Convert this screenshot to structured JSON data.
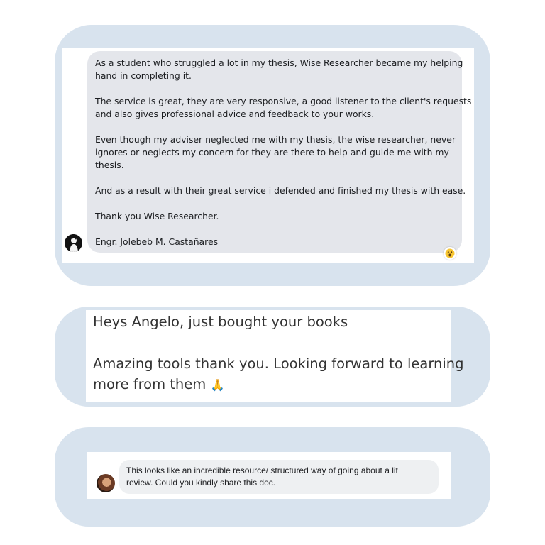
{
  "testimonial_1": {
    "paragraphs": [
      "As a student who struggled a lot in my thesis, Wise Researcher became my helping hand in completing it.",
      "The service is great, they are very responsive, a good listener to the client's requests and also gives professional advice and feedback to your works.",
      "Even though my adviser neglected me with my thesis, the wise researcher, never ignores or neglects my concern for they are there to help and guide me with my thesis.",
      "And as a result with their great service i defended and finished my thesis with ease.",
      "Thank you Wise Researcher.",
      "Engr. Jolebeb M. Castañares"
    ],
    "line_1a": "As a student who struggled a lot in my thesis, Wise Researcher became my helping",
    "line_1b": "hand in completing it.",
    "line_2a": "The service is great, they are very responsive, a good listener to the client's requests",
    "line_2b": "and also gives professional advice and feedback to your works.",
    "line_3a": "Even though my adviser neglected me with my thesis, the wise researcher, never",
    "line_3b": "ignores or neglects my concern for they are there to help and guide me with my",
    "line_3c": "thesis.",
    "line_4": "And as a result with their great service i defended and finished my thesis with ease.",
    "line_5": "Thank you Wise Researcher.",
    "signature": "Engr. Jolebeb M. Castañares",
    "reaction_icon": "wow-reaction-icon"
  },
  "testimonial_2": {
    "line_1": "Heys Angelo, just bought your books",
    "line_2": "Amazing tools thank you. Looking forward to learning",
    "line_3": "more from them",
    "emoji": "🙏"
  },
  "testimonial_3": {
    "line_1": "This looks like an incredible resource/ structured way of going about a lit",
    "line_2": "review. Could you kindly share this doc."
  },
  "colors": {
    "card_background": "#d8e3ee",
    "bubble_grey": "#e4e6eb"
  }
}
